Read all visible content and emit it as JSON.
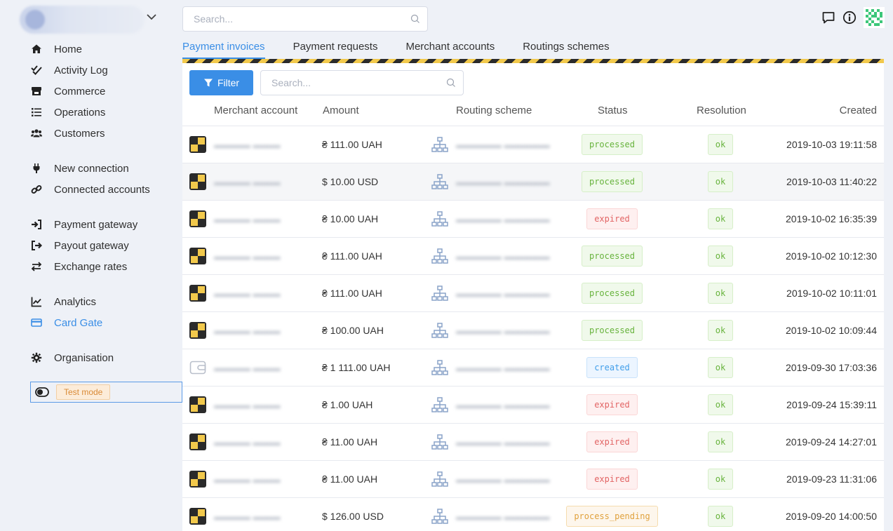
{
  "sidebar": {
    "org_name": "",
    "groups": [
      [
        {
          "label": "Home",
          "icon": "home-icon"
        },
        {
          "label": "Activity Log",
          "icon": "double-check-icon"
        },
        {
          "label": "Commerce",
          "icon": "store-icon"
        },
        {
          "label": "Operations",
          "icon": "list-icon"
        },
        {
          "label": "Customers",
          "icon": "users-icon"
        }
      ],
      [
        {
          "label": "New connection",
          "icon": "plug-icon"
        },
        {
          "label": "Connected accounts",
          "icon": "link-icon"
        }
      ],
      [
        {
          "label": "Payment gateway",
          "icon": "sign-in-icon"
        },
        {
          "label": "Payout gateway",
          "icon": "sign-out-icon"
        },
        {
          "label": "Exchange rates",
          "icon": "exchange-icon"
        }
      ],
      [
        {
          "label": "Analytics",
          "icon": "chart-line-icon"
        },
        {
          "label": "Card Gate",
          "icon": "credit-card-icon",
          "active": true
        }
      ],
      [
        {
          "label": "Organisation",
          "icon": "gear-icon"
        }
      ]
    ],
    "test_mode_label": "Test mode"
  },
  "search": {
    "placeholder": "Search..."
  },
  "tabs": [
    {
      "label": "Payment invoices",
      "active": true
    },
    {
      "label": "Payment requests"
    },
    {
      "label": "Merchant accounts"
    },
    {
      "label": "Routings schemes"
    }
  ],
  "toolbar": {
    "filter_label": "Filter",
    "search_placeholder": "Search..."
  },
  "table": {
    "columns": [
      "Merchant account",
      "Amount",
      "Routing scheme",
      "Status",
      "Resolution",
      "Created"
    ],
    "rows": [
      {
        "merchant_icon": "cube-icon",
        "amount": "₴ 111.00 UAH",
        "status": "processed",
        "resolution": "ok",
        "created": "2019-10-03 19:11:58"
      },
      {
        "merchant_icon": "cube-icon",
        "amount": "$ 10.00 USD",
        "status": "processed",
        "resolution": "ok",
        "created": "2019-10-03 11:40:22"
      },
      {
        "merchant_icon": "cube-icon",
        "amount": "₴ 10.00 UAH",
        "status": "expired",
        "resolution": "ok",
        "created": "2019-10-02 16:35:39"
      },
      {
        "merchant_icon": "cube-icon",
        "amount": "₴ 111.00 UAH",
        "status": "processed",
        "resolution": "ok",
        "created": "2019-10-02 10:12:30"
      },
      {
        "merchant_icon": "cube-icon",
        "amount": "₴ 111.00 UAH",
        "status": "processed",
        "resolution": "ok",
        "created": "2019-10-02 10:11:01"
      },
      {
        "merchant_icon": "cube-icon",
        "amount": "₴ 100.00 UAH",
        "status": "processed",
        "resolution": "ok",
        "created": "2019-10-02 10:09:44"
      },
      {
        "merchant_icon": "wallet-icon",
        "amount": "₴ 1 111.00 UAH",
        "status": "created",
        "resolution": "ok",
        "created": "2019-09-30 17:03:36"
      },
      {
        "merchant_icon": "cube-icon",
        "amount": "₴ 1.00 UAH",
        "status": "expired",
        "resolution": "ok",
        "created": "2019-09-24 15:39:11"
      },
      {
        "merchant_icon": "cube-icon",
        "amount": "₴ 11.00 UAH",
        "status": "expired",
        "resolution": "ok",
        "created": "2019-09-24 14:27:01"
      },
      {
        "merchant_icon": "cube-icon",
        "amount": "₴ 11.00 UAH",
        "status": "expired",
        "resolution": "ok",
        "created": "2019-09-23 11:31:06"
      },
      {
        "merchant_icon": "cube-icon",
        "amount": "$ 126.00 USD",
        "status": "process_pending",
        "resolution": "ok",
        "created": "2019-09-20 14:00:50"
      }
    ]
  },
  "colors": {
    "accent": "#3a8ee6",
    "hazard_yellow": "#f2c94c",
    "hazard_dark": "#2b2b2b"
  }
}
